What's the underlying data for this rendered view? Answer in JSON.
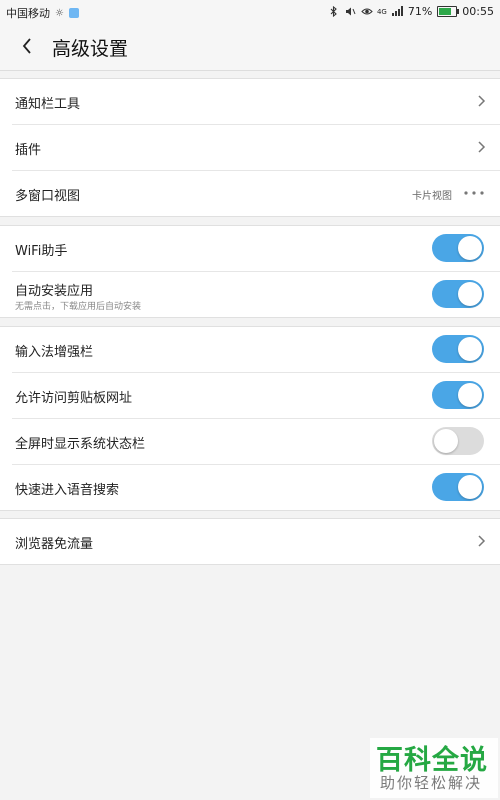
{
  "status_bar": {
    "carrier": "中国移动",
    "carrier_icon": "sun-icon",
    "network_badge": "4G",
    "battery_percent": "71%",
    "battery_level": 0.71,
    "time": "00:55"
  },
  "toolbar": {
    "title": "高级设置"
  },
  "groups": [
    {
      "rows": [
        {
          "label": "通知栏工具",
          "type": "link"
        },
        {
          "label": "插件",
          "type": "link"
        },
        {
          "label": "多窗口视图",
          "type": "select",
          "value": "卡片视图"
        }
      ]
    },
    {
      "rows": [
        {
          "label": "WiFi助手",
          "type": "toggle",
          "on": true
        },
        {
          "label": "自动安装应用",
          "sub": "无需点击，下载应用后自动安装",
          "type": "toggle",
          "on": true
        }
      ]
    },
    {
      "rows": [
        {
          "label": "输入法增强栏",
          "type": "toggle",
          "on": true
        },
        {
          "label": "允许访问剪贴板网址",
          "type": "toggle",
          "on": true
        },
        {
          "label": "全屏时显示系统状态栏",
          "type": "toggle",
          "on": false
        },
        {
          "label": "快速进入语音搜索",
          "type": "toggle",
          "on": true
        }
      ]
    },
    {
      "rows": [
        {
          "label": "浏览器免流量",
          "type": "link"
        }
      ]
    }
  ],
  "watermark": {
    "title": "百科全说",
    "subtitle": "助你轻松解决"
  },
  "colors": {
    "toggle_on": "#4aa6e6",
    "toggle_off": "#dcdcdc",
    "watermark_green": "#25a843"
  }
}
